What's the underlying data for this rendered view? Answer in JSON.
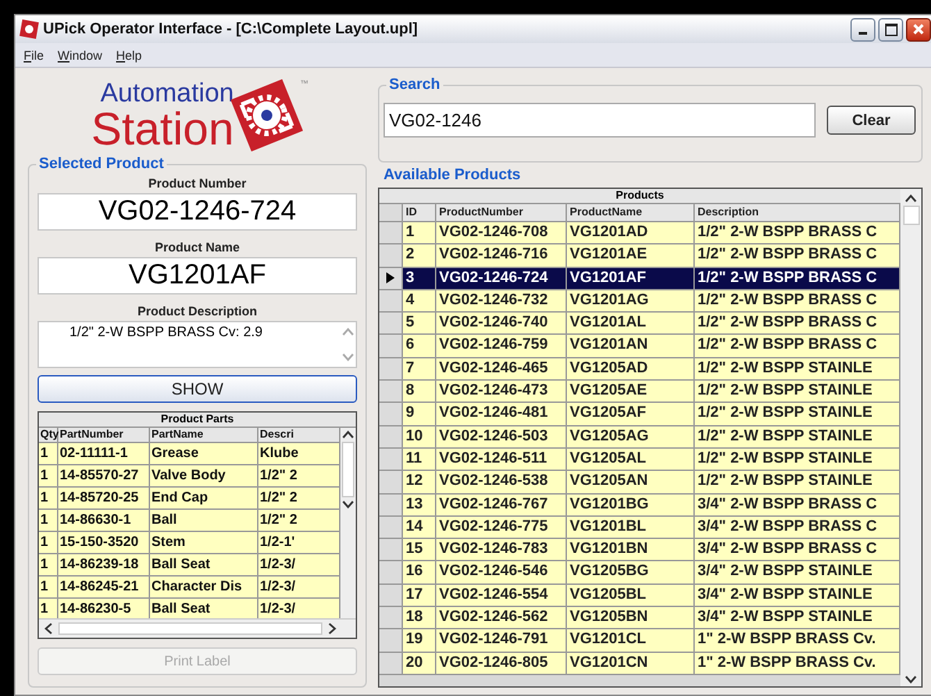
{
  "window": {
    "title": "UPick Operator Interface - [C:\\Complete Layout.upl]"
  },
  "menu": [
    {
      "label": "File"
    },
    {
      "label": "Window"
    },
    {
      "label": "Help"
    }
  ],
  "logo": {
    "line_1": "Automation",
    "line_2": "Station",
    "mark": "™"
  },
  "search": {
    "label": "Search",
    "value": "VG02-1246",
    "button": "Clear"
  },
  "selected_product": {
    "label": "Selected Product",
    "fields": [
      {
        "label": "Product Number",
        "value": "VG02-1246-724",
        "kind": "large"
      },
      {
        "label": "Product Name",
        "value": "VG1201AF",
        "kind": "large"
      },
      {
        "label": "Product Description",
        "value": "1/2\" 2-W BSPP BRASS Cv: 2.9",
        "kind": "memo"
      }
    ],
    "show_button": "SHOW",
    "parts": {
      "title": "Product Parts",
      "columns": [
        "Qty",
        "PartNumber",
        "PartName",
        "Descri"
      ],
      "rows": [
        [
          "1",
          "02-11111-1",
          "Grease",
          "Klube"
        ],
        [
          "1",
          "14-85570-27",
          "Valve Body",
          "1/2\" 2"
        ],
        [
          "1",
          "14-85720-25",
          "End Cap",
          "1/2\" 2"
        ],
        [
          "1",
          "14-86630-1",
          "Ball",
          "1/2\" 2"
        ],
        [
          "1",
          "15-150-3520",
          "Stem",
          "1/2-1'"
        ],
        [
          "1",
          "14-86239-18",
          "Ball Seat",
          "1/2-3/"
        ],
        [
          "1",
          "14-86245-21",
          "Character Dis",
          "1/2-3/"
        ],
        [
          "1",
          "14-86230-5",
          "Ball Seat",
          "1/2-3/"
        ]
      ]
    },
    "print_button": {
      "label": "Print Label",
      "disabled": true
    }
  },
  "available_products": {
    "label": "Available Products",
    "title": "Products",
    "columns": [
      "ID",
      "ProductNumber",
      "ProductName",
      "Description"
    ],
    "rows": [
      {
        "cells": [
          "1",
          "VG02-1246-708",
          "VG1201AD",
          "1/2\" 2-W BSPP BRASS C"
        ],
        "selected": false
      },
      {
        "cells": [
          "2",
          "VG02-1246-716",
          "VG1201AE",
          "1/2\" 2-W BSPP BRASS C"
        ],
        "selected": false
      },
      {
        "cells": [
          "3",
          "VG02-1246-724",
          "VG1201AF",
          "1/2\" 2-W BSPP BRASS C"
        ],
        "selected": true
      },
      {
        "cells": [
          "4",
          "VG02-1246-732",
          "VG1201AG",
          "1/2\" 2-W BSPP BRASS C"
        ],
        "selected": false
      },
      {
        "cells": [
          "5",
          "VG02-1246-740",
          "VG1201AL",
          "1/2\" 2-W BSPP BRASS C"
        ],
        "selected": false
      },
      {
        "cells": [
          "6",
          "VG02-1246-759",
          "VG1201AN",
          "1/2\" 2-W BSPP BRASS C"
        ],
        "selected": false
      },
      {
        "cells": [
          "7",
          "VG02-1246-465",
          "VG1205AD",
          "1/2\" 2-W BSPP STAINLE"
        ],
        "selected": false
      },
      {
        "cells": [
          "8",
          "VG02-1246-473",
          "VG1205AE",
          "1/2\" 2-W BSPP STAINLE"
        ],
        "selected": false
      },
      {
        "cells": [
          "9",
          "VG02-1246-481",
          "VG1205AF",
          "1/2\" 2-W BSPP STAINLE"
        ],
        "selected": false
      },
      {
        "cells": [
          "10",
          "VG02-1246-503",
          "VG1205AG",
          "1/2\" 2-W BSPP STAINLE"
        ],
        "selected": false
      },
      {
        "cells": [
          "11",
          "VG02-1246-511",
          "VG1205AL",
          "1/2\" 2-W BSPP STAINLE"
        ],
        "selected": false
      },
      {
        "cells": [
          "12",
          "VG02-1246-538",
          "VG1205AN",
          "1/2\" 2-W BSPP STAINLE"
        ],
        "selected": false
      },
      {
        "cells": [
          "13",
          "VG02-1246-767",
          "VG1201BG",
          "3/4\" 2-W BSPP BRASS C"
        ],
        "selected": false
      },
      {
        "cells": [
          "14",
          "VG02-1246-775",
          "VG1201BL",
          "3/4\" 2-W BSPP BRASS C"
        ],
        "selected": false
      },
      {
        "cells": [
          "15",
          "VG02-1246-783",
          "VG1201BN",
          "3/4\" 2-W BSPP BRASS C"
        ],
        "selected": false
      },
      {
        "cells": [
          "16",
          "VG02-1246-546",
          "VG1205BG",
          "3/4\" 2-W BSPP STAINLE"
        ],
        "selected": false
      },
      {
        "cells": [
          "17",
          "VG02-1246-554",
          "VG1205BL",
          "3/4\" 2-W BSPP STAINLE"
        ],
        "selected": false
      },
      {
        "cells": [
          "18",
          "VG02-1246-562",
          "VG1205BN",
          "3/4\" 2-W BSPP STAINLE"
        ],
        "selected": false
      },
      {
        "cells": [
          "19",
          "VG02-1246-791",
          "VG1201CL",
          "1\" 2-W BSPP BRASS Cv."
        ],
        "selected": false
      },
      {
        "cells": [
          "20",
          "VG02-1246-805",
          "VG1201CN",
          "1\" 2-W BSPP BRASS Cv."
        ],
        "selected": false
      }
    ]
  }
}
